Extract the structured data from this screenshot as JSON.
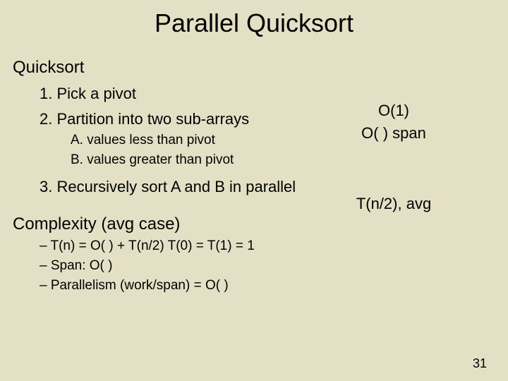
{
  "title": "Parallel Quicksort",
  "section1": "Quicksort",
  "steps": {
    "s1": "1. Pick a pivot",
    "s2": "2. Partition into two sub-arrays",
    "s2a": "A. values less than pivot",
    "s2b": "B. values greater than pivot",
    "s3": "3. Recursively sort A and B in parallel"
  },
  "notes": {
    "n1": "O(1)",
    "n2": "O(      ) span",
    "n3": "T(n/2), avg"
  },
  "section2": "Complexity (avg case)",
  "complexity": {
    "c1": "–   T(n) = O(       ) + T(n/2)            T(0) = T(1) = 1",
    "c2": "–   Span:  O(        )",
    "c3": "–   Parallelism (work/span) = O(             )"
  },
  "page": "31"
}
